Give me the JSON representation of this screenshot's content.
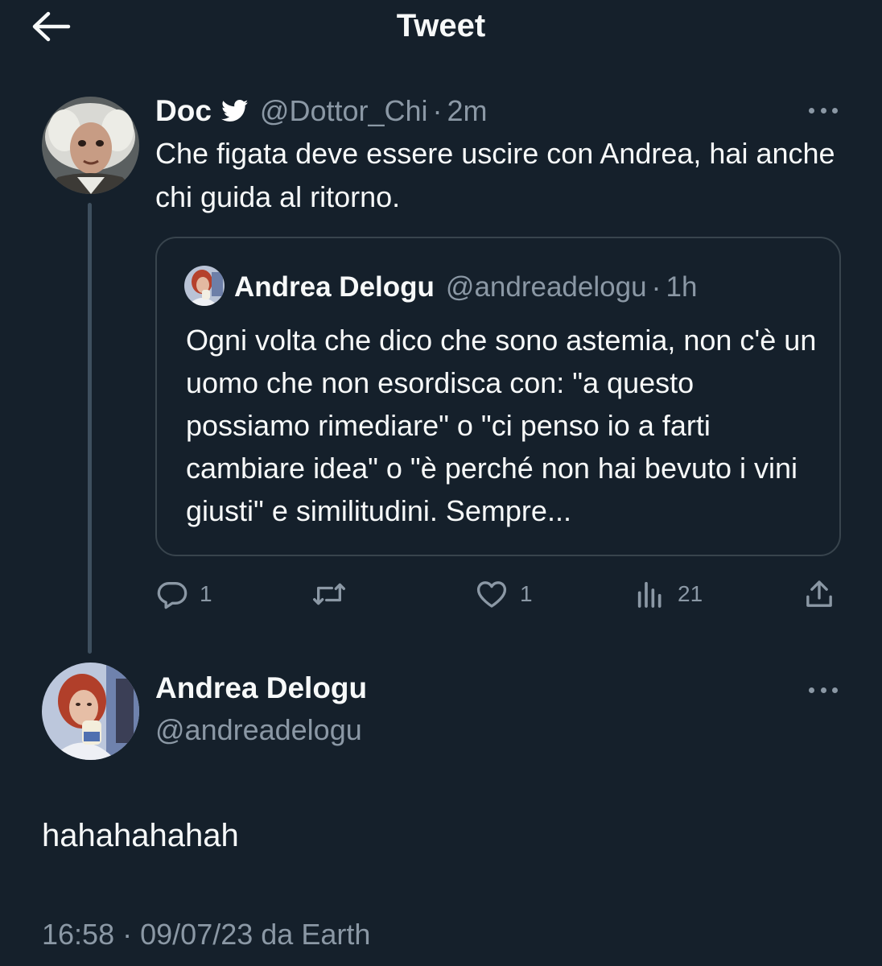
{
  "header": {
    "title": "Tweet",
    "back_icon": "arrow-left-icon"
  },
  "colors": {
    "background": "#15202b",
    "text_primary": "#f7f9f9",
    "text_secondary": "#8b98a5",
    "border": "#38444d",
    "verified_badge": "#ffffff"
  },
  "parent_tweet": {
    "author_name": "Doc",
    "verified_icon": "twitter-bird-icon",
    "handle": "@Dottor_Chi",
    "separator": "·",
    "time": "2m",
    "text": "Che figata deve essere uscire con Andrea, hai anche chi guida al ritorno.",
    "quoted_tweet": {
      "author_name": "Andrea Delogu",
      "handle": "@andreadelogu",
      "separator": "·",
      "time": "1h",
      "text": "Ogni volta che dico che sono astemia, non c'è un uomo che non esordisca con: \"a questo possiamo rimediare\" o \"ci penso io a farti cambiare idea\" o \"è perché non hai bevuto i vini giusti\" e similitudini. Sempre..."
    },
    "actions": {
      "reply": {
        "icon": "reply-icon",
        "count": "1"
      },
      "retweet": {
        "icon": "retweet-icon",
        "count": ""
      },
      "like": {
        "icon": "heart-icon",
        "count": "1"
      },
      "views": {
        "icon": "views-icon",
        "count": "21"
      },
      "share": {
        "icon": "share-icon"
      }
    }
  },
  "main_tweet": {
    "author_name": "Andrea Delogu",
    "handle": "@andreadelogu",
    "text": "hahahahahah",
    "time": "16:58",
    "separator": "·",
    "date": "09/07/23",
    "via_prefix": "da",
    "source": "Earth"
  }
}
